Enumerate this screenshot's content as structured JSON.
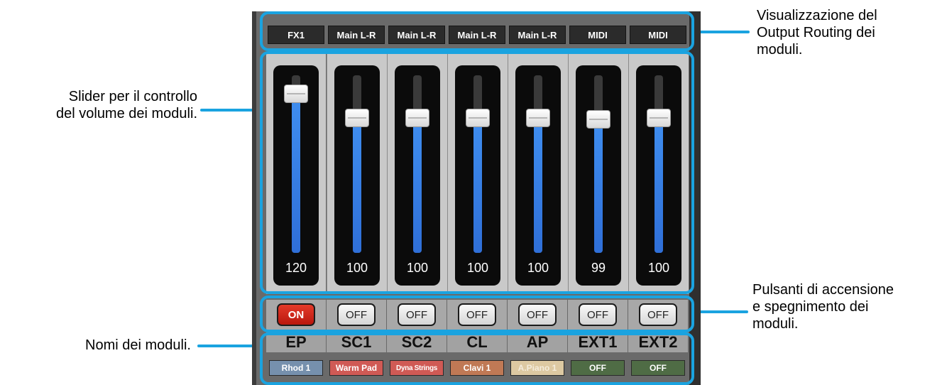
{
  "annotations": {
    "routing": [
      "Visualizzazione del",
      "Output Routing dei",
      "moduli."
    ],
    "sliders": [
      "Slider per il controllo",
      "del volume dei moduli."
    ],
    "power": [
      "Pulsanti di accensione",
      "e spegnimento dei",
      "moduli."
    ],
    "names": [
      "Nomi dei moduli."
    ]
  },
  "colors": {
    "accent": "#1aa3e0",
    "fader_fill": "#3f8ef0",
    "on_button": "#d42a1c"
  },
  "modules": [
    {
      "routing": "FX1",
      "volume": 120,
      "volume_fraction": 0.94,
      "power": "ON",
      "name": "EP",
      "preset": "Rhod 1",
      "preset_color": "#7690ad",
      "preset_text_color": "#ffffff"
    },
    {
      "routing": "Main L-R",
      "volume": 100,
      "volume_fraction": 0.79,
      "power": "OFF",
      "name": "SC1",
      "preset": "Warm Pad",
      "preset_color": "#d05a55",
      "preset_text_color": "#ffffff"
    },
    {
      "routing": "Main L-R",
      "volume": 100,
      "volume_fraction": 0.79,
      "power": "OFF",
      "name": "SC2",
      "preset": "Dyna Strings",
      "preset_color": "#d05a55",
      "preset_text_color": "#ffffff"
    },
    {
      "routing": "Main L-R",
      "volume": 100,
      "volume_fraction": 0.79,
      "power": "OFF",
      "name": "CL",
      "preset": "Clavi 1",
      "preset_color": "#c07955",
      "preset_text_color": "#ffffff"
    },
    {
      "routing": "Main L-R",
      "volume": 100,
      "volume_fraction": 0.79,
      "power": "OFF",
      "name": "AP",
      "preset": "A.Piano 1",
      "preset_color": "#ddc9a2",
      "preset_text_color": "#f4ecdc"
    },
    {
      "routing": "MIDI",
      "volume": 99,
      "volume_fraction": 0.78,
      "power": "OFF",
      "name": "EXT1",
      "preset": "OFF",
      "preset_color": "#4f6c45",
      "preset_text_color": "#ffffff"
    },
    {
      "routing": "MIDI",
      "volume": 100,
      "volume_fraction": 0.79,
      "power": "OFF",
      "name": "EXT2",
      "preset": "OFF",
      "preset_color": "#4f6c45",
      "preset_text_color": "#ffffff"
    }
  ]
}
